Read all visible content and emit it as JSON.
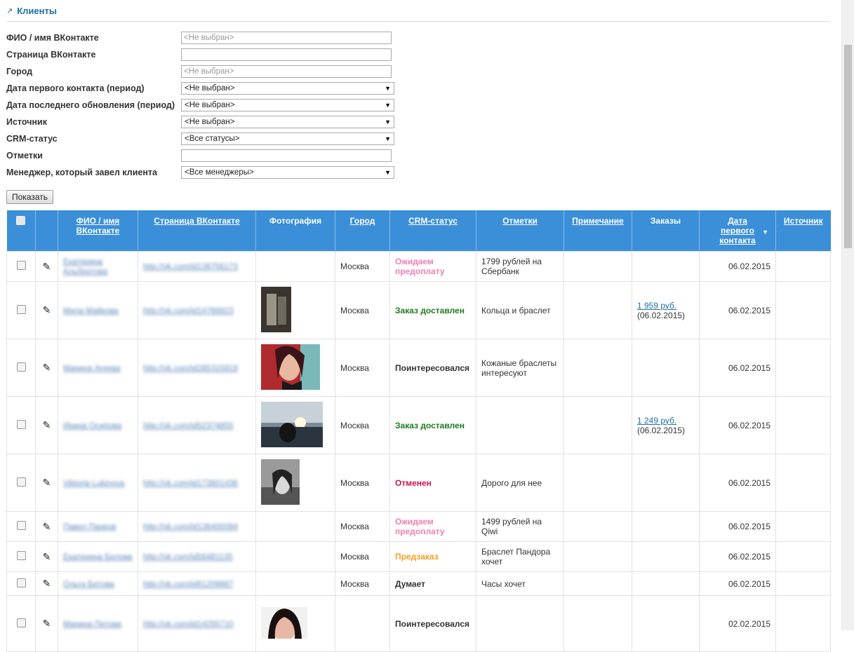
{
  "header": {
    "arrow": "↗",
    "title": "Клиенты"
  },
  "filters": [
    {
      "label": "ФИО / имя ВКонтакте",
      "type": "input",
      "value": "<Не выбран>"
    },
    {
      "label": "Страница ВКонтакте",
      "type": "input",
      "value": ""
    },
    {
      "label": "Город",
      "type": "input",
      "value": "<Не выбран>"
    },
    {
      "label": "Дата первого контакта (период)",
      "type": "select",
      "value": "<Не выбран>"
    },
    {
      "label": "Дата последнего обновления (период)",
      "type": "select",
      "value": "<Не выбран>"
    },
    {
      "label": "Источник",
      "type": "select",
      "value": "<Не выбран>"
    },
    {
      "label": "CRM-статус",
      "type": "select",
      "value": "<Все статусы>"
    },
    {
      "label": "Отметки",
      "type": "input",
      "value": ""
    },
    {
      "label": "Менеджер, который завел клиента",
      "type": "select",
      "value": "<Все менеджеры>"
    }
  ],
  "show_button": "Показать",
  "table": {
    "columns": {
      "name": "ФИО / имя ВКонтакте",
      "page": "Страница ВКонтакте",
      "photo": "Фотография",
      "city": "Город",
      "crm": "CRM-статус",
      "marks": "Отметки",
      "note": "Примечание",
      "orders": "Заказы",
      "date": "Дата первого контакта",
      "source": "Источник"
    },
    "rows": [
      {
        "name": "Екатерина Альбертова",
        "page": "http://vk.com/id138756173",
        "photo": "",
        "city": "Москва",
        "status": "Ожидаем предоплату",
        "status_color": "#f27fb2",
        "marks": "1799 рублей на Сбербанк",
        "order_amount": "",
        "order_date": "",
        "date": "06.02.2015"
      },
      {
        "name": "Мила Майкова",
        "page": "http://vk.com/id14766823",
        "photo": "photo-1",
        "city": "Москва",
        "status": "Заказ доставлен",
        "status_color": "#1f7a1f",
        "marks": "Кольца и браслет",
        "order_amount": "1 959 руб.",
        "order_date": "(06.02.2015)",
        "date": "06.02.2015"
      },
      {
        "name": "Марина Агеева",
        "page": "http://vk.com/id285315919",
        "photo": "photo-2",
        "city": "Москва",
        "status": "Поинтересовался",
        "status_color": "#333333",
        "marks": "Кожаные браслеты интересуют",
        "order_amount": "",
        "order_date": "",
        "date": "06.02.2015"
      },
      {
        "name": "Ирина Осипова",
        "page": "http://vk.com/id52374855",
        "photo": "photo-3",
        "city": "Москва",
        "status": "Заказ доставлен",
        "status_color": "#1f7a1f",
        "marks": "",
        "order_amount": "1 249 руб.",
        "order_date": "(06.02.2015)",
        "date": "06.02.2015"
      },
      {
        "name": "Viktoria Lukinova",
        "page": "http://vk.com/id173801436",
        "photo": "photo-4",
        "city": "Москва",
        "status": "Отменен",
        "status_color": "#d0124f",
        "marks": "Дорого для нее",
        "order_amount": "",
        "order_date": "",
        "date": "06.02.2015"
      },
      {
        "name": "Павел Панков",
        "page": "http://vk.com/id136400084",
        "photo": "",
        "city": "Москва",
        "status": "Ожидаем предоплату",
        "status_color": "#f27fb2",
        "marks": "1499 рублей на Qiwi",
        "order_amount": "",
        "order_date": "",
        "date": "06.02.2015"
      },
      {
        "name": "Екатерина Белова",
        "page": "http://vk.com/id56481135",
        "photo": "",
        "city": "Москва",
        "status": "Предзаказ",
        "status_color": "#f0a020",
        "marks": "Браслет Пандора хочет",
        "order_amount": "",
        "order_date": "",
        "date": "06.02.2015"
      },
      {
        "name": "Ольга Битова",
        "page": "http://vk.com/id61209987",
        "photo": "",
        "city": "Москва",
        "status": "Думает",
        "status_color": "#333333",
        "marks": "Часы хочет",
        "order_amount": "",
        "order_date": "",
        "date": "06.02.2015"
      },
      {
        "name": "Марина Петова",
        "page": "http://vk.com/id14255710",
        "photo": "photo-5",
        "city": "",
        "status": "Поинтересовался",
        "status_color": "#333333",
        "marks": "",
        "order_amount": "",
        "order_date": "",
        "date": "02.02.2015"
      }
    ]
  }
}
